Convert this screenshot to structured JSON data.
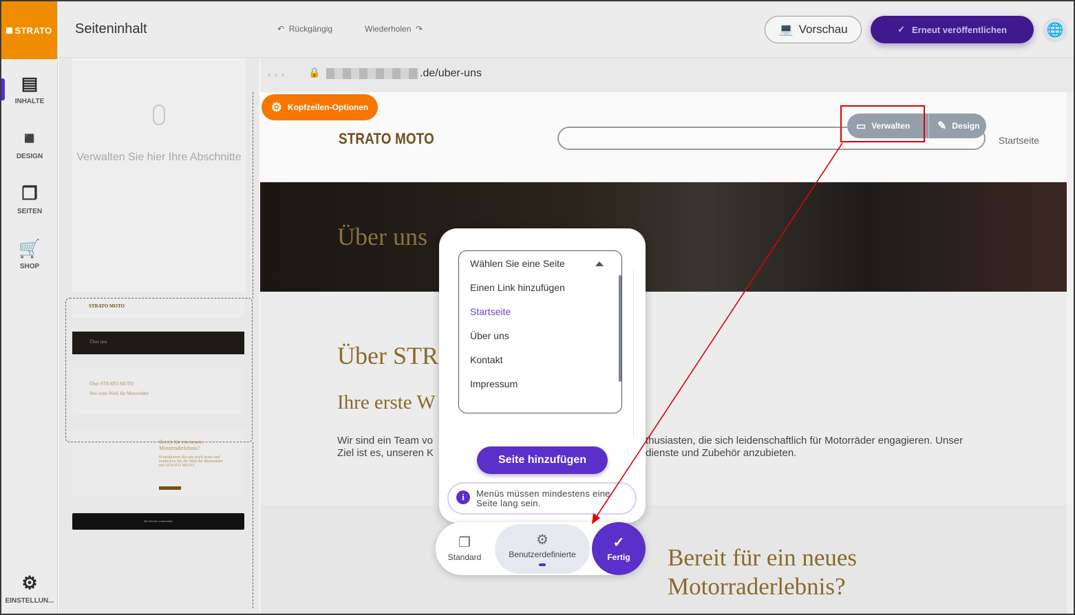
{
  "app": {
    "logo": "STRATO",
    "page_title": "Seiteninhalt",
    "undo_label": "Rückgängig",
    "redo_label": "Wiederholen",
    "preview_label": "Vorschau",
    "publish_label": "Erneut veröffentlichen"
  },
  "rail": {
    "items": [
      {
        "label": "INHALTE",
        "icon": "content-icon"
      },
      {
        "label": "DESIGN",
        "icon": "design-icon"
      },
      {
        "label": "SEITEN",
        "icon": "pages-icon"
      },
      {
        "label": "SHOP",
        "icon": "cart-icon"
      }
    ],
    "settings_label": "EINSTELLUN..."
  },
  "panel": {
    "hint": "Verwalten Sie hier Ihre Abschnitte",
    "thumbs": {
      "header_logo": "STRATO MOTO",
      "hero_title": "Über uns",
      "about_title": "Über STRATO MOTO",
      "about_sub": "Ihre erste Wahl für Motorräder",
      "cta_title": "Bereit für ein neues Motorraderlebnis?",
      "cta_text": "Kontaktieren Sie uns noch heute und entdecken Sie die Welt der Motorräder mit STRATO MOTO.",
      "footer_text": "Alle Rechte vorbehalten"
    }
  },
  "browser": {
    "url_suffix": ".de/uber-uns"
  },
  "site": {
    "header_options_label": "Kopfzeilen-Optionen",
    "logo": "STRATO MOTO",
    "nav_item": "Startseite",
    "manage_label": "Verwalten",
    "design_label": "Design",
    "hero_title": "Über uns",
    "about_title": "Über STR",
    "about_sub": "Ihre erste W",
    "about_body_left": "Wir sind ein Team vo",
    "about_body_left2": "Ziel ist es, unseren K",
    "about_body_right": "thusiasten, die sich leidenschaftlich für Motorräder engagieren. Unser",
    "about_body_right2": "dienste und Zubehör anzubieten.",
    "cta_title": "Bereit für ein neues Motorraderlebnis?"
  },
  "dialog": {
    "select_placeholder": "Wählen Sie eine Seite",
    "options": [
      "Einen Link hinzufügen",
      "Startseite",
      "Über uns",
      "Kontakt",
      "Impressum"
    ],
    "selected_option": "Startseite",
    "add_page_label": "Seite hinzufügen",
    "info_text": "Menüs müssen mindestens eine Seite lang sein.",
    "tabs": [
      {
        "label": "Standard",
        "icon": "copy-icon"
      },
      {
        "label": "Benutzerdefinierte",
        "icon": "gear-hand-icon"
      },
      {
        "label": "Fertig",
        "icon": "check-icon"
      }
    ]
  },
  "colors": {
    "brand_orange": "#f08c00",
    "accent_purple": "#5b2fc9",
    "publish_purple": "#3f1a8f",
    "annotation_red": "#e00000",
    "heading_gold": "#8a6a2a"
  }
}
